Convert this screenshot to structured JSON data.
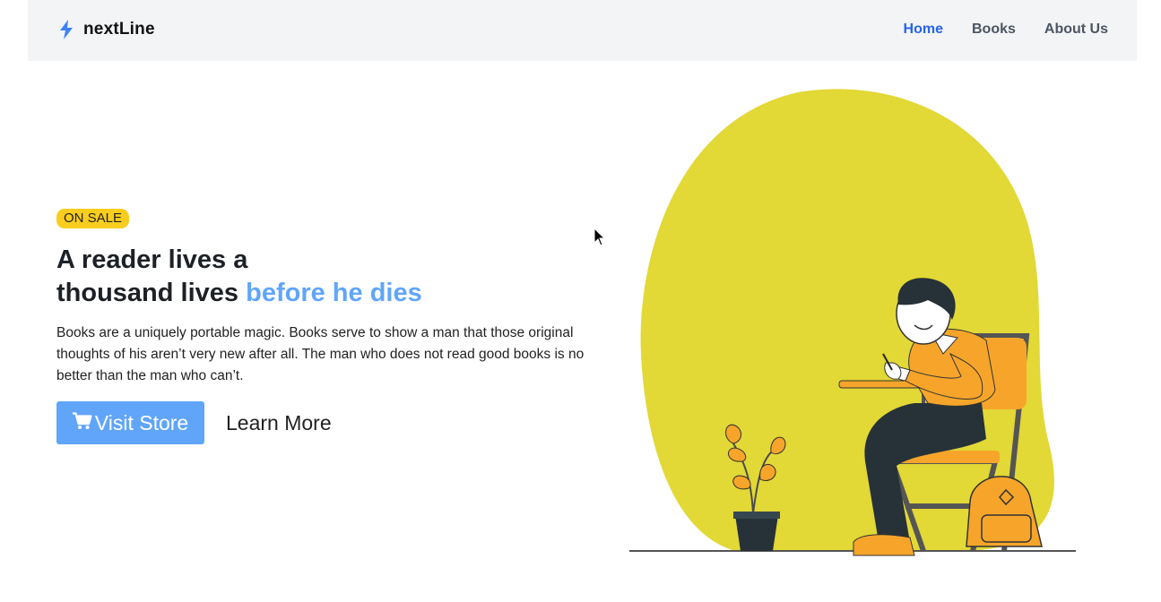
{
  "nav": {
    "brand": "nextLine",
    "links": [
      {
        "label": "Home",
        "active": true
      },
      {
        "label": "Books",
        "active": false
      },
      {
        "label": "About Us",
        "active": false
      }
    ]
  },
  "hero": {
    "badge": "ON SALE",
    "headline_line1": "A reader lives a",
    "headline_line2_plain": "thousand lives ",
    "headline_line2_accent": "before he dies",
    "description": "Books are a uniquely portable magic. Books serve to show a man that those original thoughts of his aren’t very new after all. The man who does not read good books is no better than the man who can’t.",
    "primary_button": "Visit Store",
    "secondary_button": "Learn More"
  },
  "icons": {
    "brand": "lightning-bolt-icon",
    "primary_button": "shopping-cart-icon"
  },
  "colors": {
    "accent": "#60a5fa",
    "nav_active": "#2563eb",
    "badge": "#f9cd1e",
    "blob": "#e2d836",
    "shirt": "#f6a52a"
  }
}
